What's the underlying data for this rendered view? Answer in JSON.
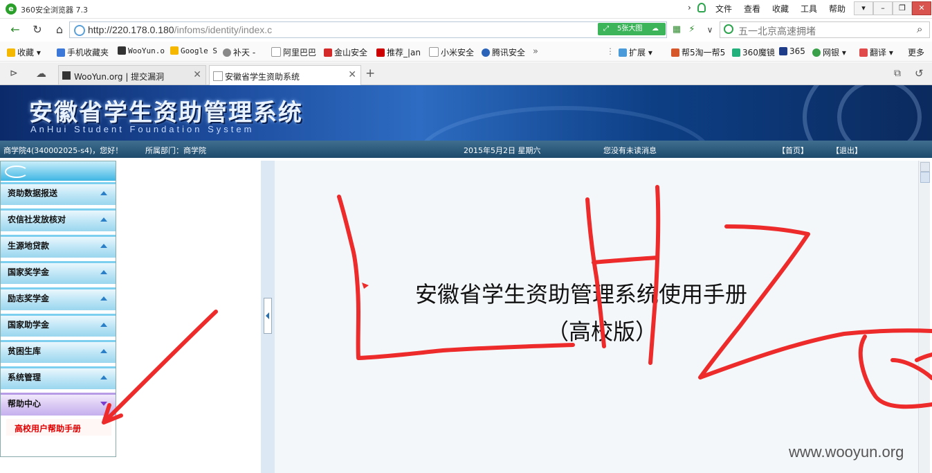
{
  "browser": {
    "title": "360安全浏览器 7.3",
    "menu": [
      "文件",
      "查看",
      "收藏",
      "工具",
      "帮助"
    ],
    "url_host": "http://220.178.0.180",
    "url_path": "/infoms/identity/index.c",
    "image_button": "5张大图",
    "search_placeholder": "五一北京高速拥堵",
    "bookmarks": [
      "收藏",
      "手机收藏夹",
      "WooYun.o",
      "Google S",
      "补天 -",
      "阿里巴巴",
      "金山安全",
      "推荐_|an",
      "小米安全",
      "腾讯安全"
    ],
    "bookmarks_right": [
      "扩展",
      "帮5淘一帮5",
      "360魔镜",
      "365",
      "网银",
      "翻译",
      "更多"
    ],
    "tabs": [
      {
        "label": "WooYun.org | 提交漏洞"
      },
      {
        "label": "安徽省学生资助系统"
      }
    ]
  },
  "banner": {
    "title_cn": "安徽省学生资助管理系统",
    "title_en": "AnHui Student Foundation System"
  },
  "status": {
    "user": "商学院4(340002025-s4)，您好！",
    "dept": "所属部门：商学院",
    "date": "2015年5月2日  星期六",
    "messages": "您没有未读消息",
    "home": "【首页】",
    "logout": "【退出】"
  },
  "menu": {
    "items": [
      "资助数据报送",
      "农信社发放核对",
      "生源地贷款",
      "国家奖学金",
      "励志奖学金",
      "国家助学金",
      "贫困生库",
      "系统管理",
      "帮助中心"
    ],
    "subitem": "高校用户帮助手册"
  },
  "content": {
    "title": "安徽省学生资助管理系统使用手册",
    "subtitle": "（高校版）"
  },
  "watermark": "www.wooyun.org",
  "colors": {
    "annotation": "#ee2b2b",
    "banner": "#1e4ea0"
  }
}
